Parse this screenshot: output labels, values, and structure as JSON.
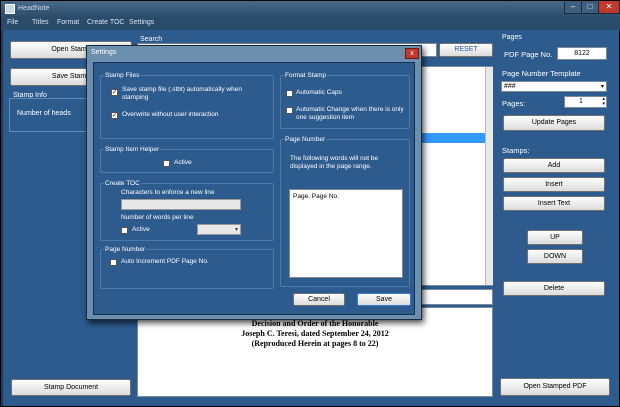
{
  "window": {
    "title": "HeadNote"
  },
  "menu": [
    "File",
    "Titles",
    "Format",
    "Create TOC",
    "Settings"
  ],
  "left": {
    "open_stamp": "Open Stamp",
    "save_stamp": "Save Stamp",
    "stamp_info": "Stamp Info",
    "number_of_heads": "Number of heads",
    "stamp_document": "Stamp Document"
  },
  "center": {
    "search_label": "Search",
    "reset_button": "RESET",
    "doc_lines": [
      "Decision and Order of the Honorable",
      "Joseph C. Teresi, dated September 24, 2012",
      "(Reproduced Herein at pages 8 to 22)"
    ]
  },
  "right": {
    "pages_label": "Pages",
    "pdf_page_no_label": "PDF Page No.",
    "pdf_page_no_value": "8122",
    "page_number_template_label": "Page Number Template",
    "template_value": "###",
    "pages_count_label": "Pages:",
    "pages_count_value": "1",
    "update_pages": "Update Pages",
    "stamps_label": "Stamps:",
    "add": "Add",
    "insert": "Insert",
    "insert_text": "Insert Text",
    "up": "UP",
    "down": "DOWN",
    "delete": "Delete",
    "open_stamped_pdf": "Open Stamped PDF"
  },
  "dialog": {
    "title": "Settings",
    "close": "x",
    "stamp_files": {
      "label": "Stamp Files",
      "save_label": "Save stamp file (.stbt) automatically when stamping",
      "save_checked": true,
      "overwrite_label": "Overwrite without user interaction",
      "overwrite_checked": true
    },
    "stamp_item_helper": {
      "label": "Stamp Item Helper",
      "active_label": "Active",
      "active_checked": false
    },
    "create_toc": {
      "label": "Create TOC",
      "chars_label": "Characters to enforce a new line",
      "chars_value": "",
      "words_label": "Number of words per line",
      "active_label": "Active",
      "active_checked": false,
      "words_value": ""
    },
    "page_number": {
      "label": "Page Number",
      "auto_label": "Auto Increment PDF Page No.",
      "auto_checked": false
    },
    "format_stamp": {
      "label": "Format Stamp",
      "auto_caps_label": "Automatic Caps",
      "auto_caps_checked": false,
      "auto_change_label": "Automatic Change when there is only one suggestion item",
      "auto_change_checked": false
    },
    "page_number_right": {
      "label": "Page Number",
      "description": "The following words will not be displayed in the page range.",
      "words": "Page, Page No."
    },
    "cancel": "Cancel",
    "save": "Save"
  }
}
